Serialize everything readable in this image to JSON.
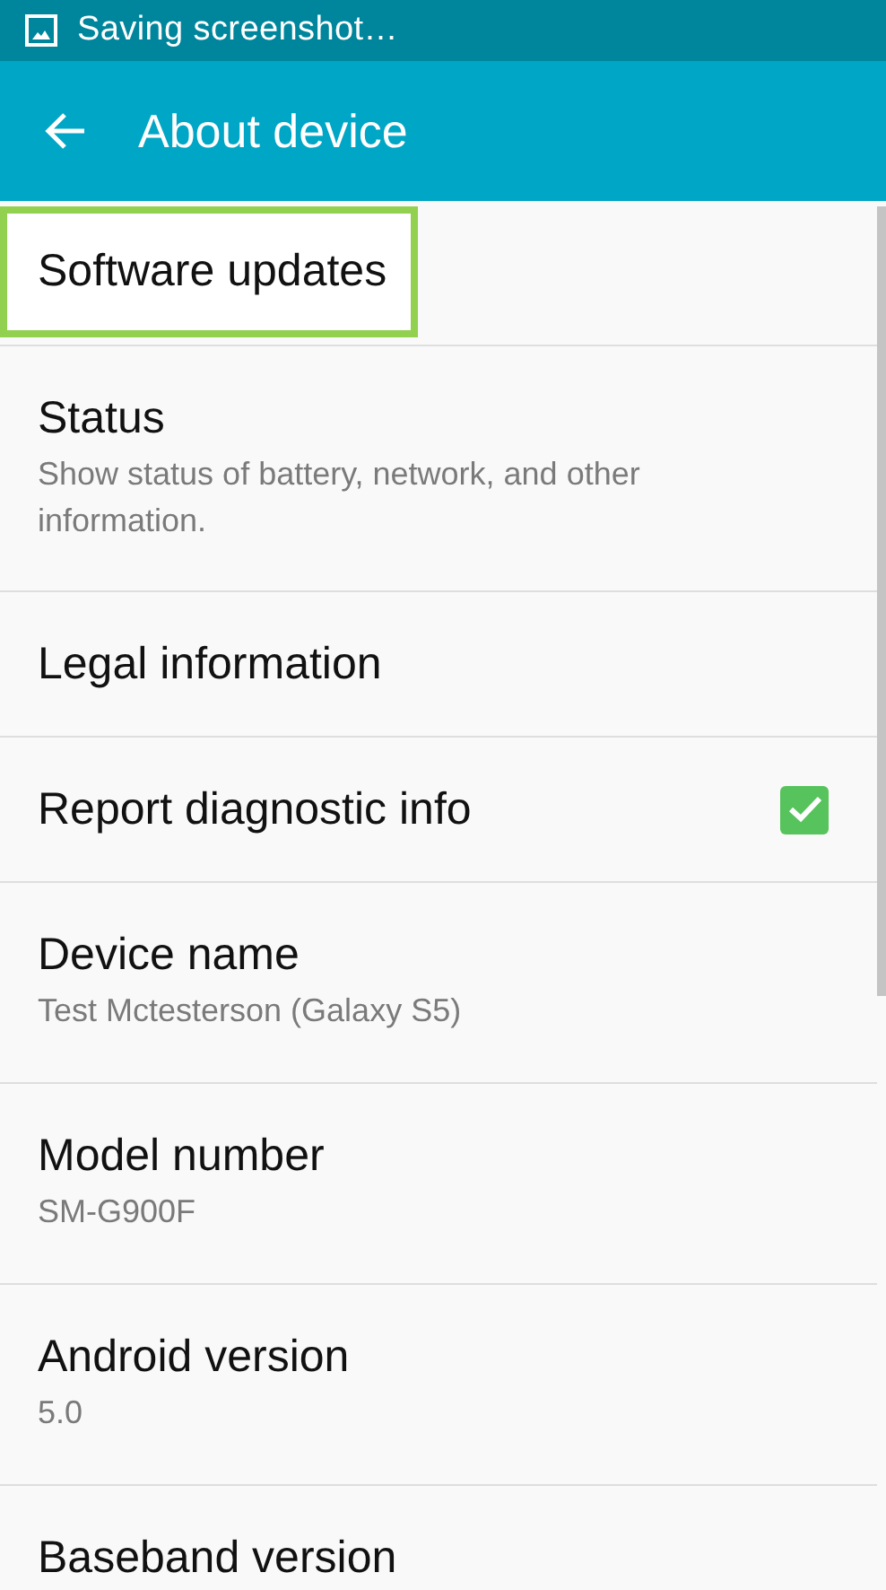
{
  "status_bar": {
    "notification": "Saving screenshot…"
  },
  "app_bar": {
    "title": "About device"
  },
  "items": [
    {
      "kind": "plain",
      "title": "Software updates",
      "highlighted": true
    },
    {
      "kind": "plain",
      "title": "Status",
      "summary": "Show status of battery, network, and other information.",
      "highlighted": false
    },
    {
      "kind": "plain",
      "title": "Legal information",
      "highlighted": false
    },
    {
      "kind": "checkbox",
      "title": "Report diagnostic info",
      "checked": true,
      "highlighted": false
    },
    {
      "kind": "plain",
      "title": "Device name",
      "summary": "Test Mctesterson (Galaxy S5)",
      "highlighted": false
    },
    {
      "kind": "plain",
      "title": "Model number",
      "summary": "SM-G900F",
      "highlighted": false
    },
    {
      "kind": "plain",
      "title": "Android version",
      "summary": "5.0",
      "highlighted": false
    },
    {
      "kind": "plain",
      "title": "Baseband version",
      "highlighted": false
    }
  ]
}
